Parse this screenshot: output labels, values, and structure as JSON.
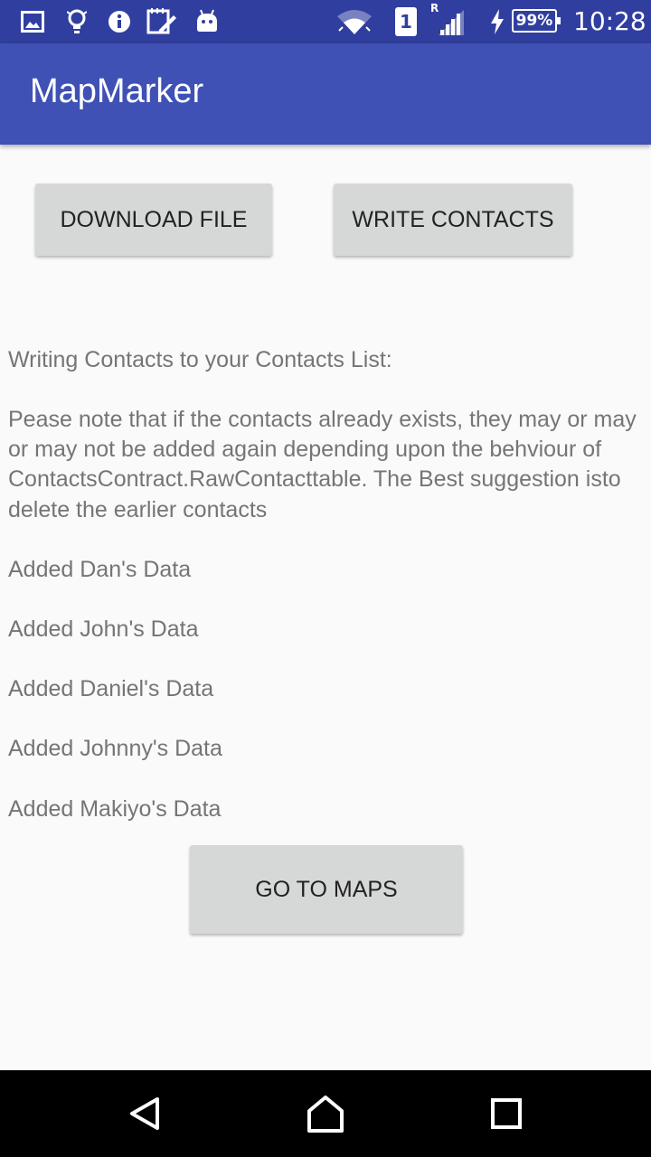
{
  "status_bar": {
    "time": "10:28",
    "battery_percent": "99%",
    "sim_slot": "1",
    "roaming_indicator": "R",
    "left_icons": [
      "image-icon",
      "lightbulb-icon",
      "info-icon",
      "edit-note-icon",
      "android-icon"
    ],
    "right_icons": [
      "wifi-icon",
      "sim-icon",
      "signal-icon",
      "charging-icon",
      "battery-icon"
    ]
  },
  "app_bar": {
    "title": "MapMarker"
  },
  "buttons": {
    "download_file": "Download File",
    "write_contacts": "Write Contacts",
    "go_to_maps": "Go To Maps"
  },
  "log": {
    "lines": [
      "Writing Contacts to your Contacts List:",
      "Pease note that if the contacts already exists, they may or may or may not be added again depending upon the behviour of ContactsContract.RawContacttable. The Best suggestion isto delete the earlier contacts",
      "Added Dan's Data",
      "Added John's Data",
      "Added Daniel's Data",
      "Added Johnny's Data",
      "Added Makiyo's Data"
    ]
  },
  "nav_bar": {
    "items": [
      "back-icon",
      "home-icon",
      "recents-icon"
    ]
  },
  "colors": {
    "status_bar": "#303f9f",
    "app_bar": "#3f51b5",
    "background": "#fafafa",
    "button": "#d6d7d7",
    "log_text": "#757575"
  }
}
